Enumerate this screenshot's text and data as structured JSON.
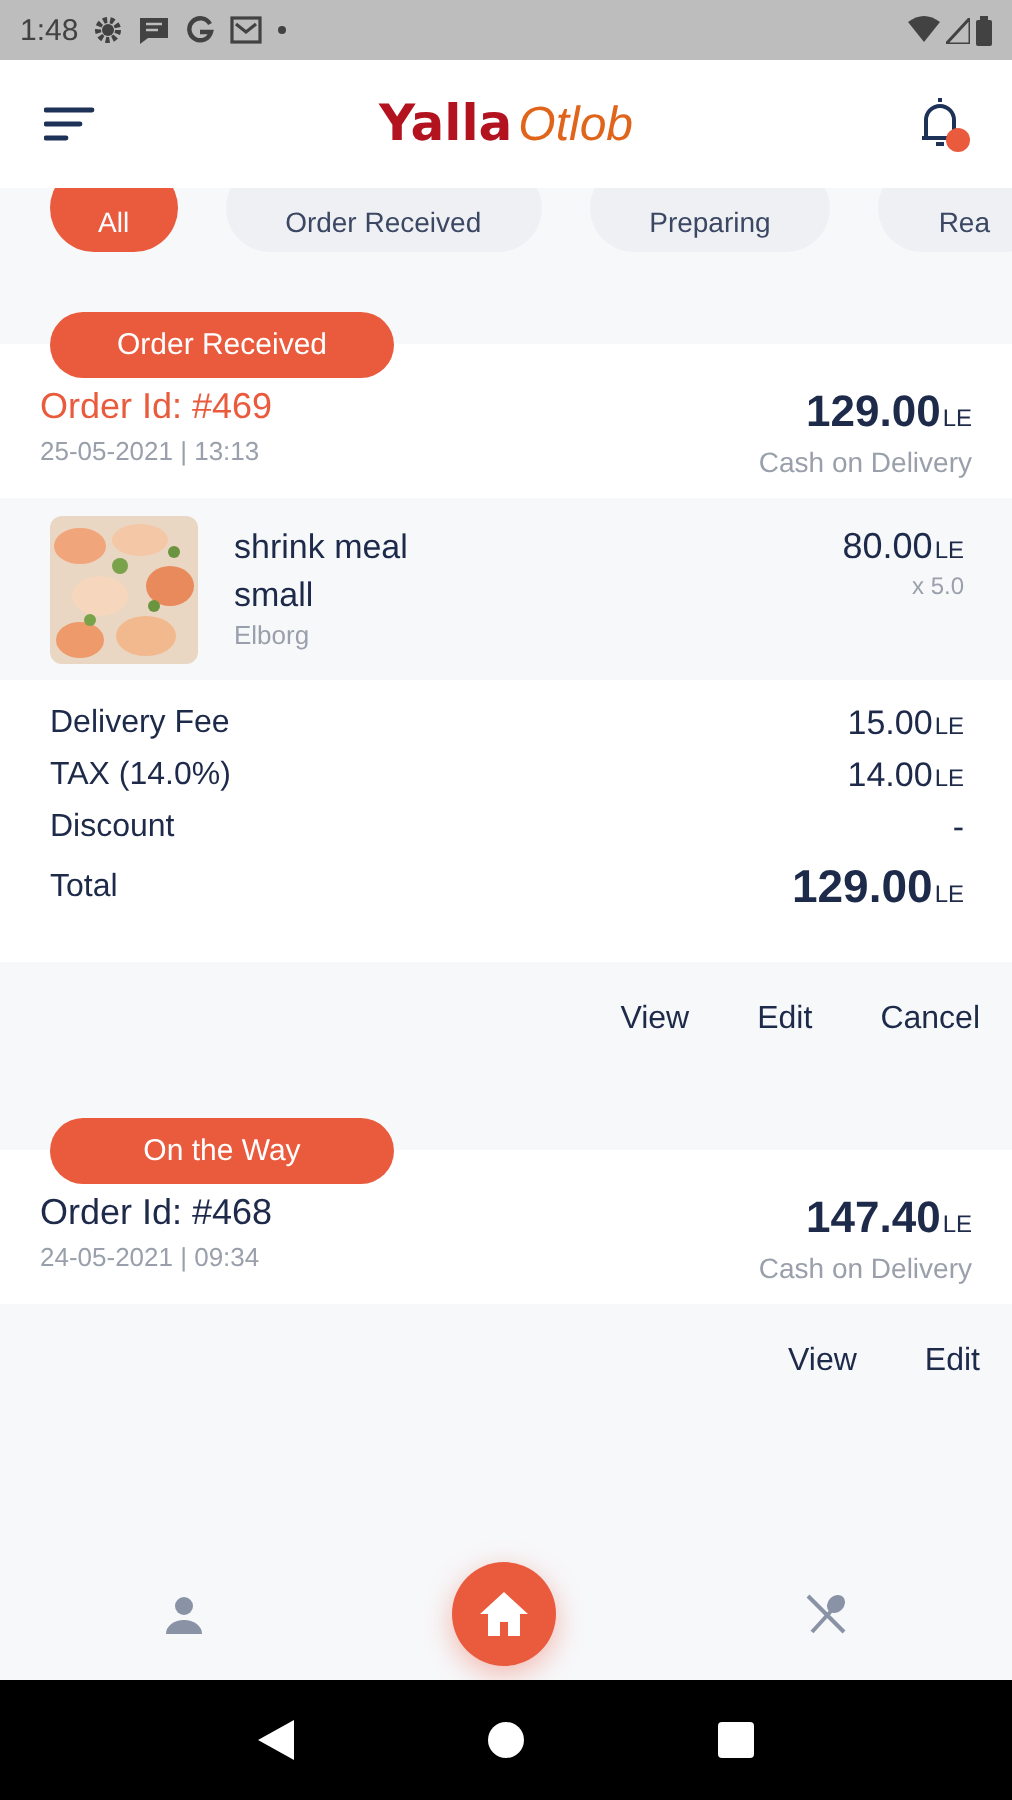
{
  "status_bar": {
    "time": "1:48"
  },
  "header": {
    "brand_first": "Yalla",
    "brand_second": "Otlob"
  },
  "filters": [
    {
      "label": "All",
      "selected": true
    },
    {
      "label": "Order Received",
      "selected": false
    },
    {
      "label": "Preparing",
      "selected": false
    },
    {
      "label": "Rea",
      "selected": false
    }
  ],
  "orders": [
    {
      "status": "Order Received",
      "order_id": "Order Id: #469",
      "highlighted": true,
      "date": "25-05-2021 | 13:13",
      "total": "129.00",
      "currency": "LE",
      "payment": "Cash on Delivery",
      "items": [
        {
          "kind": "picture",
          "name": "shrink meal small",
          "restaurant": "Elborg",
          "price": "80.00",
          "currency": "LE",
          "quantity": "x 5.0"
        }
      ],
      "summary": [
        {
          "kind": "line",
          "label": "Delivery Fee",
          "value": "15.00",
          "currency": "LE"
        },
        {
          "kind": "line",
          "label": "TAX (14.0%)",
          "value": "14.00",
          "currency": "LE"
        },
        {
          "kind": "line",
          "label": "Discount",
          "value": "-"
        },
        {
          "kind": "total",
          "label": "Total",
          "value": "129.00",
          "currency": "LE"
        }
      ],
      "actions": [
        "View",
        "Edit",
        "Cancel"
      ]
    },
    {
      "status": "On the Way",
      "order_id": "Order Id: #468",
      "highlighted": false,
      "date": "24-05-2021 | 09:34",
      "total": "147.40",
      "currency": "LE",
      "payment": "Cash on Delivery",
      "actions": [
        "View",
        "Edit"
      ]
    }
  ],
  "bottom_nav": [
    {
      "kind": "profile",
      "selected": false
    },
    {
      "kind": "home",
      "selected": true
    },
    {
      "kind": "restaurant",
      "selected": false
    }
  ]
}
